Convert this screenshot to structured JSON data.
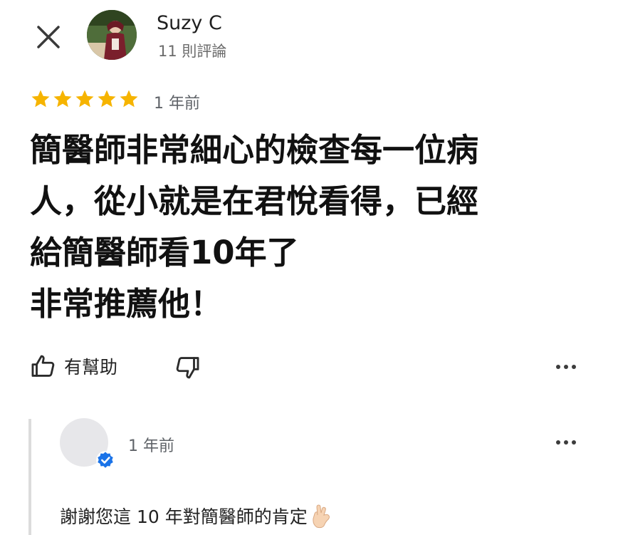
{
  "review": {
    "author_name": "Suzy C",
    "author_review_count": "11 則評論",
    "rating": 5,
    "rating_max": 5,
    "time": "1 年前",
    "text": "簡醫師非常細心的檢查每一位病\n人，從小就是在君悅看得，已經\n給簡醫師看10年了\n非常推薦他！"
  },
  "actions": {
    "helpful_label": "有幫助"
  },
  "owner_reply": {
    "time": "1 年前",
    "text": "謝謝您這 10 年對簡醫師的肯定"
  },
  "icons": {
    "close": "close-icon",
    "like": "thumbs-up-icon",
    "dislike": "thumbs-down-icon",
    "more": "more-horizontal-icon",
    "verified": "verified-badge-icon",
    "emoji": "hand-emoji-icon"
  },
  "colors": {
    "star": "#F6B400",
    "verified": "#1A73E8",
    "text_secondary": "#5F6368"
  }
}
